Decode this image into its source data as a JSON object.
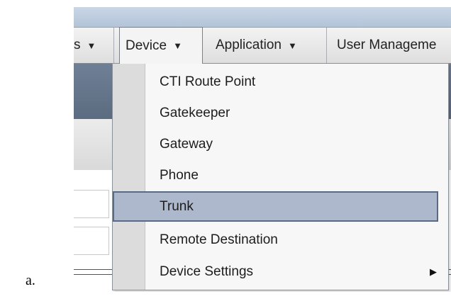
{
  "caption": "a.",
  "menubar": {
    "items": [
      {
        "label": "s",
        "has_dropdown": true
      },
      {
        "label": "Device",
        "has_dropdown": true,
        "active": true
      },
      {
        "label": "Application",
        "has_dropdown": true
      },
      {
        "label": "User Manageme",
        "has_dropdown": false
      }
    ],
    "caret_icon": "caret-down-icon"
  },
  "device_menu": {
    "items": [
      {
        "label": "CTI Route Point"
      },
      {
        "label": "Gatekeeper"
      },
      {
        "label": "Gateway"
      },
      {
        "label": "Phone"
      },
      {
        "label": "Trunk",
        "selected": true
      },
      {
        "label": "Remote Destination"
      },
      {
        "label": "Device Settings",
        "has_submenu": true
      }
    ],
    "submenu_icon": "caret-right-icon"
  },
  "colors": {
    "menu_highlight": "#aeb8cc",
    "highlight_border": "#5a6a84",
    "header_band": "#66778c"
  }
}
